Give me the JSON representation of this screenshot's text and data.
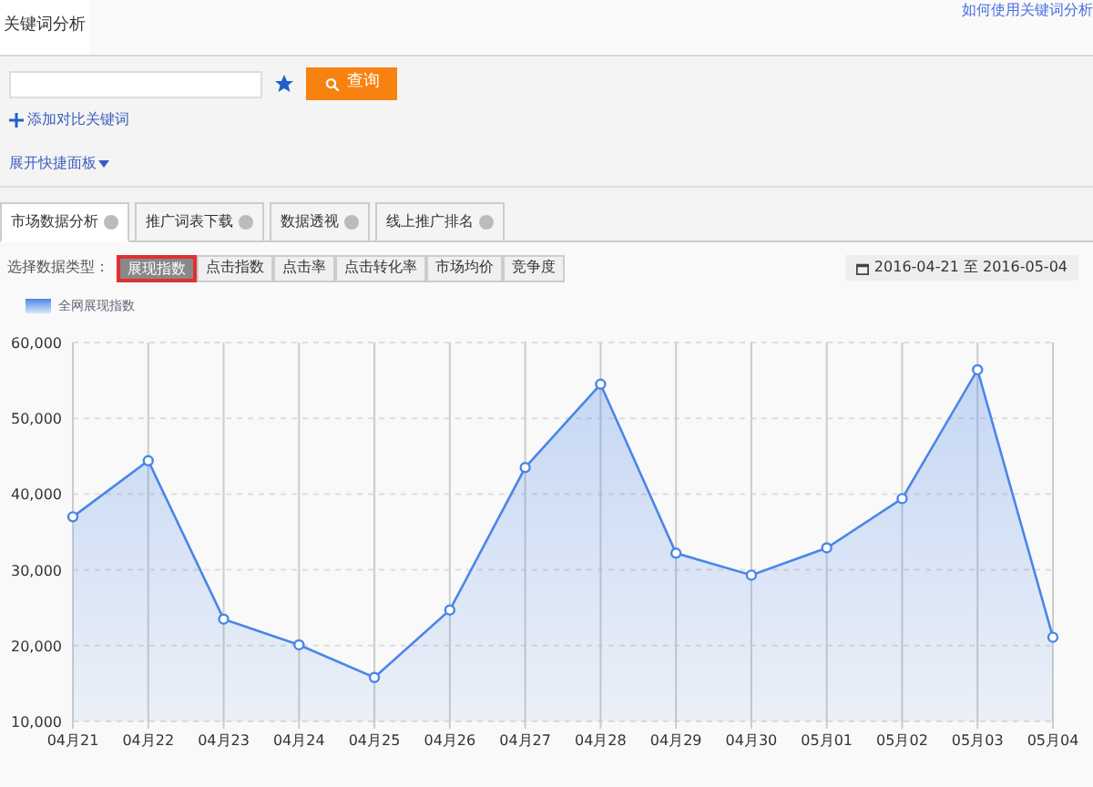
{
  "header": {
    "tab": "关键词分析",
    "help_link": "如何使用关键词分析"
  },
  "search": {
    "button": "查询",
    "add_link": "添加对比关键词",
    "panel_link": "展开快捷面板"
  },
  "tabs": [
    {
      "label": "市场数据分析",
      "selected": true
    },
    {
      "label": "推广词表下载",
      "selected": false
    },
    {
      "label": "数据透视",
      "selected": false
    },
    {
      "label": "线上推广排名",
      "selected": false
    }
  ],
  "metrics": {
    "label": "选择数据类型：",
    "items": [
      {
        "label": "展现指数",
        "selected": true
      },
      {
        "label": "点击指数",
        "selected": false
      },
      {
        "label": "点击率",
        "selected": false
      },
      {
        "label": "点击转化率",
        "selected": false
      },
      {
        "label": "市场均价",
        "selected": false
      },
      {
        "label": "竞争度",
        "selected": false
      }
    ],
    "date_range": "2016-04-21 至 2016-05-04"
  },
  "chart_data": {
    "type": "area",
    "grid": true,
    "categories": [
      "04月21",
      "04月22",
      "04月23",
      "04月24",
      "04月25",
      "04月26",
      "04月27",
      "04月28",
      "04月29",
      "04月30",
      "05月01",
      "05月02",
      "05月03",
      "05月04"
    ],
    "series": [
      {
        "name": "全网展现指数",
        "color": "#4a86e8",
        "values": [
          37000,
          44400,
          23500,
          20100,
          15800,
          24700,
          43500,
          54500,
          32200,
          29300,
          32900,
          39400,
          56400,
          21100
        ]
      }
    ],
    "ylim": [
      10000,
      60000
    ],
    "yticks": [
      {
        "value": 10000,
        "label": "10,000"
      },
      {
        "value": 20000,
        "label": "20,000"
      },
      {
        "value": 30000,
        "label": "30,000"
      },
      {
        "value": 40000,
        "label": "40,000"
      },
      {
        "value": 50000,
        "label": "50,000"
      },
      {
        "value": 60000,
        "label": "60,000"
      }
    ]
  }
}
